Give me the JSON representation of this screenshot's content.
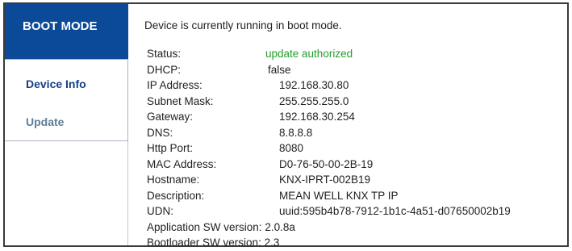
{
  "sidebar": {
    "brand": "BOOT MODE",
    "items": [
      {
        "label": "Device Info"
      },
      {
        "label": "Update"
      }
    ]
  },
  "main": {
    "heading": "Device is currently running in boot mode.",
    "rows": [
      {
        "label": "Status:",
        "value": "update authorized"
      },
      {
        "label": "DHCP:",
        "value": "false"
      },
      {
        "label": "IP Address:",
        "value": "192.168.30.80"
      },
      {
        "label": "Subnet Mask:",
        "value": "255.255.255.0"
      },
      {
        "label": "Gateway:",
        "value": "192.168.30.254"
      },
      {
        "label": "DNS:",
        "value": "8.8.8.8"
      },
      {
        "label": "Http Port:",
        "value": "8080"
      },
      {
        "label": "MAC Address:",
        "value": "D0-76-50-00-2B-19"
      },
      {
        "label": "Hostname:",
        "value": "KNX-IPRT-002B19"
      },
      {
        "label": "Description:",
        "value": "MEAN WELL KNX TP IP"
      },
      {
        "label": "UDN:",
        "value": "uuid:595b4b78-7912-1b1c-4a51-d07650002b19"
      },
      {
        "label": "Application SW version:",
        "value": "2.0.8a"
      },
      {
        "label": "Bootloader SW version:",
        "value": "2.3"
      }
    ]
  },
  "colors": {
    "brand_bg": "#0b4a97",
    "status_ok": "#22a02a",
    "nav_active": "#153f86",
    "nav_inactive": "#5e7f96"
  }
}
